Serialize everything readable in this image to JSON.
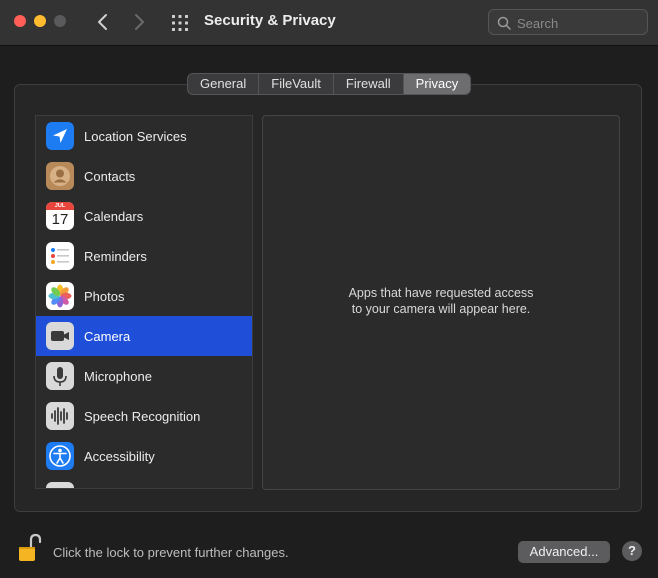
{
  "window": {
    "title": "Security & Privacy"
  },
  "search": {
    "placeholder": "Search"
  },
  "tabs": [
    {
      "label": "General"
    },
    {
      "label": "FileVault"
    },
    {
      "label": "Firewall"
    },
    {
      "label": "Privacy"
    }
  ],
  "active_tab": "Privacy",
  "privacy_list": {
    "items": [
      {
        "label": "Location Services",
        "icon": "location-arrow-icon"
      },
      {
        "label": "Contacts",
        "icon": "contacts-icon"
      },
      {
        "label": "Calendars",
        "icon": "calendar-icon",
        "calendar_month": "JUL",
        "calendar_day": "17"
      },
      {
        "label": "Reminders",
        "icon": "reminders-icon"
      },
      {
        "label": "Photos",
        "icon": "photos-icon"
      },
      {
        "label": "Camera",
        "icon": "camera-icon"
      },
      {
        "label": "Microphone",
        "icon": "microphone-icon"
      },
      {
        "label": "Speech Recognition",
        "icon": "speech-recognition-icon"
      },
      {
        "label": "Accessibility",
        "icon": "accessibility-icon"
      }
    ],
    "selected": "Camera"
  },
  "detail": {
    "message_line1": "Apps that have requested access",
    "message_line2": "to your camera will appear here."
  },
  "footer": {
    "lock_text": "Click the lock to prevent further changes.",
    "advanced_label": "Advanced...",
    "help_label": "?"
  },
  "colors": {
    "selection": "#1f4fd8",
    "close": "#ff5f57",
    "minimize": "#febc2e",
    "lock": "#f5b522"
  }
}
